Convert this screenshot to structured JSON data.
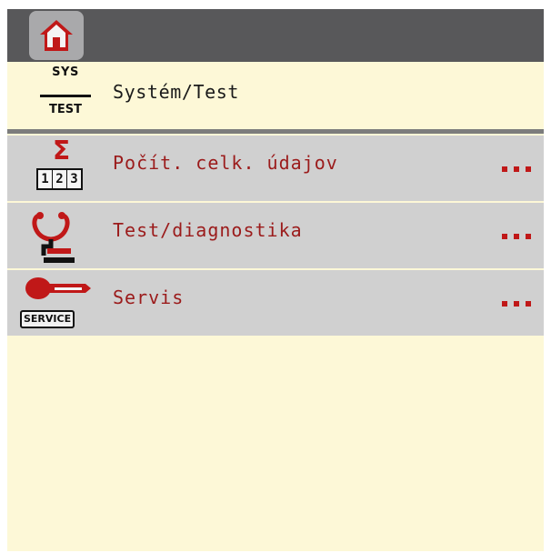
{
  "home": {
    "icon": "home-icon"
  },
  "header": {
    "icon": "sys-test-icon",
    "icon_top": "SYS",
    "icon_bottom": "TEST",
    "title": "Systém/Test"
  },
  "menu": {
    "items": [
      {
        "label": "Počít. celk. údajov",
        "icon": "sigma-counter-icon",
        "digits": [
          "1",
          "2",
          "3"
        ],
        "more": "..."
      },
      {
        "label": "Test/diagnostika",
        "icon": "stethoscope-icon",
        "more": "..."
      },
      {
        "label": "Servis",
        "icon": "service-key-icon",
        "icon_text": "SERVICE",
        "more": "..."
      }
    ]
  },
  "colors": {
    "background": "#fdf8d7",
    "topbar": "#58585a",
    "menu_item": "#d0d0d0",
    "label_red": "#9b1b1b",
    "accent_red": "#c01818"
  }
}
